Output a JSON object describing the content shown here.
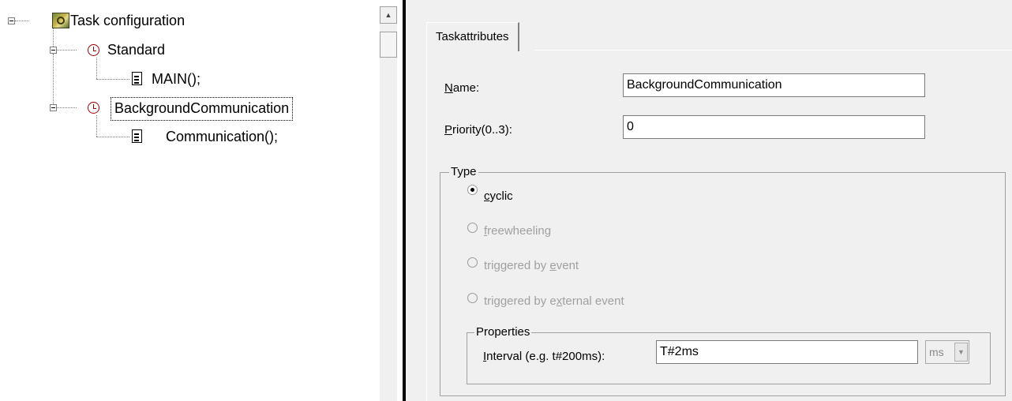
{
  "tree": {
    "root_label": "Task configuration",
    "items": [
      {
        "label": "Standard",
        "children": [
          {
            "label": "MAIN();"
          }
        ]
      },
      {
        "label": "BackgroundCommunication",
        "selected": true,
        "children": [
          {
            "label": "Communication();"
          }
        ]
      }
    ]
  },
  "scrollbar": {
    "up_arrow": "▲"
  },
  "tabs": [
    {
      "label": "Taskattributes",
      "active": true
    }
  ],
  "form": {
    "name_label": "Name:",
    "name_value": "BackgroundCommunication",
    "priority_label": "Priority(0..3):",
    "priority_value": "0"
  },
  "type_group": {
    "title": "Type",
    "options": [
      {
        "label": "cyclic",
        "checked": true,
        "enabled": true
      },
      {
        "label": "freewheeling",
        "checked": false,
        "enabled": false
      },
      {
        "label": "triggered by event",
        "checked": false,
        "enabled": false
      },
      {
        "label": "triggered by external event",
        "checked": false,
        "enabled": false
      }
    ]
  },
  "properties_group": {
    "title": "Properties",
    "interval_label": "Interval (e.g. t#200ms):",
    "interval_value": "T#2ms",
    "unit_value": "ms",
    "unit_arrow": "▼"
  },
  "colors": {
    "clock": "#a00000",
    "disabled_text": "#a0a0a0",
    "panel": "#f0f0f0"
  }
}
